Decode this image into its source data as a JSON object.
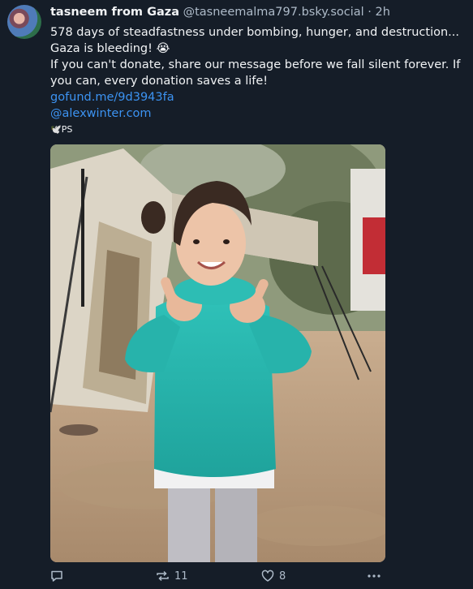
{
  "post": {
    "author_name": "tasneem from Gaza",
    "handle": "@tasneemalma797.bsky.social",
    "separator": "·",
    "time": "2h",
    "line1": "578 days of steadfastness under bombing, hunger, and destruction... Gaza is bleeding! 😭",
    "line2": "If you can't donate, share our message before we fall silent forever. If you can, every donation saves a life!",
    "link1": "gofund.me/9d3943fa",
    "link2": "@alexwinter.com",
    "signature": "🕊️PS"
  },
  "image": {
    "subject": "child in teal hoodie giving thumbs up in front of tents"
  },
  "actions": {
    "reply_icon": "reply-icon",
    "repost_icon": "repost-icon",
    "repost_count": "11",
    "like_icon": "heart-icon",
    "like_count": "8",
    "more_icon": "more-icon"
  },
  "colors": {
    "background": "#151d28",
    "link": "#3c93f2",
    "muted": "#aebbc9"
  }
}
